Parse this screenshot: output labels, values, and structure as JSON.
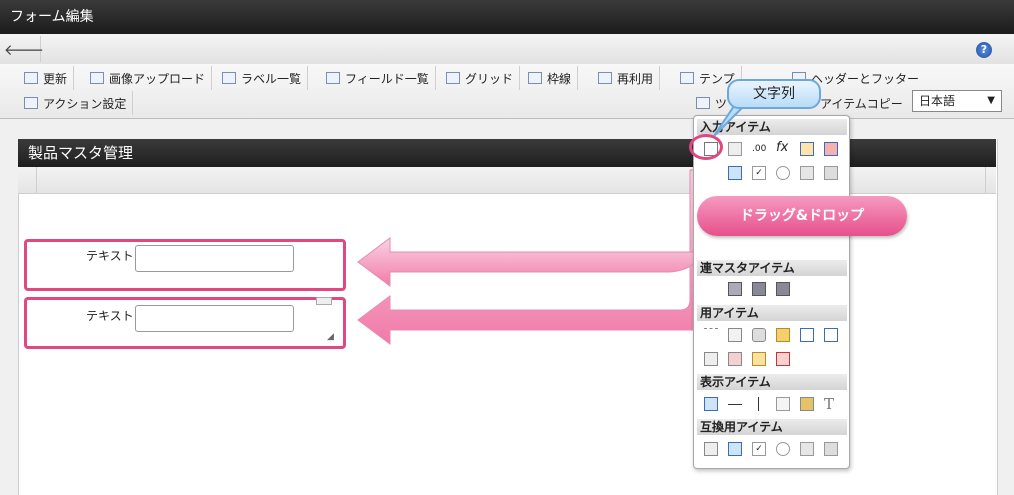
{
  "title": "フォーム編集",
  "help_icon": "?",
  "toolbar": {
    "row1": [
      "更新",
      "画像アップロード",
      "ラベル一覧",
      "フィールド一覧",
      "グリッド",
      "枠線",
      "再利用",
      "テンプ",
      "ヘッダーとフッター"
    ],
    "row2": [
      "アクション設定"
    ],
    "ts": "ツ",
    "item_copy": "アイテムコピー"
  },
  "language": {
    "selected": "日本語"
  },
  "form": {
    "title": "製品マスタ管理",
    "items": [
      {
        "label": "テキスト",
        "value": ""
      },
      {
        "label": "テキスト",
        "value": ""
      }
    ]
  },
  "palette": {
    "sections": [
      "入力アイテム",
      "連マスタアイテム",
      "用アイテム",
      "表示アイテム",
      "互換用アイテム"
    ],
    "glyph_fx": "fx",
    "glyph_num": ".00",
    "glyph_T": "T"
  },
  "callouts": {
    "tooltip": "文字列",
    "drag": "ドラッグ&ドロップ"
  },
  "colors": {
    "accent": "#e0487f",
    "header": "#2a2a2a",
    "callout": "#b9dcf7"
  }
}
